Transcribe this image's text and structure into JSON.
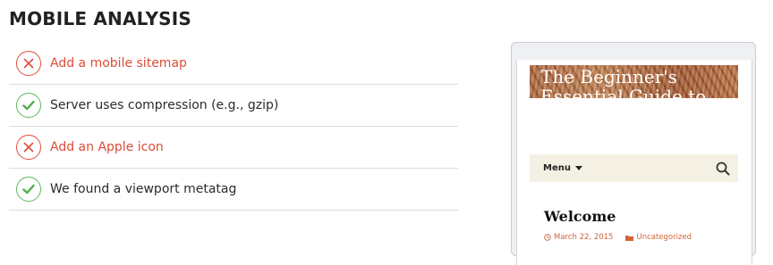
{
  "section_title": "MOBILE ANALYSIS",
  "checks": [
    {
      "status": "fail",
      "icon": "x-circle-icon",
      "label": "Add a mobile sitemap"
    },
    {
      "status": "pass",
      "icon": "check-circle-icon",
      "label": "Server uses compression (e.g., gzip)"
    },
    {
      "status": "fail",
      "icon": "x-circle-icon",
      "label": "Add an Apple icon"
    },
    {
      "status": "pass",
      "icon": "check-circle-icon",
      "label": "We found a viewport metatag"
    }
  ],
  "preview": {
    "header_title": "The Beginner's Essential Guide to",
    "menu_label": "Menu",
    "post_title": "Welcome",
    "post_date": "March 22, 2015",
    "post_category": "Uncategorized"
  },
  "colors": {
    "fail": "#de4c38",
    "pass": "#5cb85c",
    "accent": "#d2643a"
  }
}
